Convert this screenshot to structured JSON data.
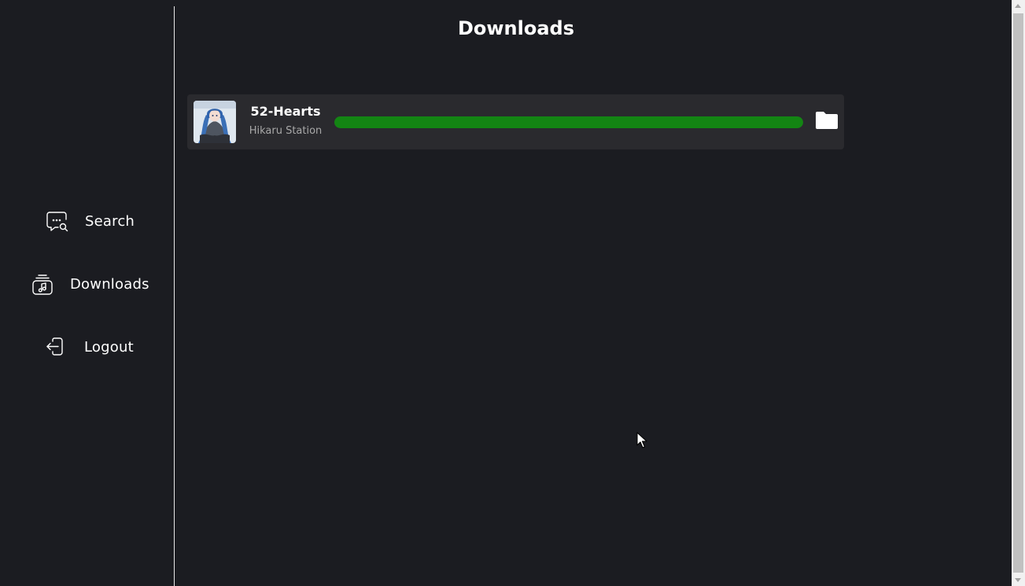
{
  "sidebar": {
    "items": [
      {
        "label": "Search",
        "icon": "search-chat-icon"
      },
      {
        "label": "Downloads",
        "icon": "music-stack-icon"
      },
      {
        "label": "Logout",
        "icon": "logout-icon"
      }
    ]
  },
  "main": {
    "title": "Downloads",
    "downloads": [
      {
        "title": "52-Hearts",
        "artist": "Hikaru Station",
        "progress": 1.0,
        "action_icon": "folder-icon"
      }
    ]
  },
  "colors": {
    "background": "#1b1c21",
    "card": "#2a2a2e",
    "progress": "#138513",
    "divider": "#e8e8e8"
  }
}
